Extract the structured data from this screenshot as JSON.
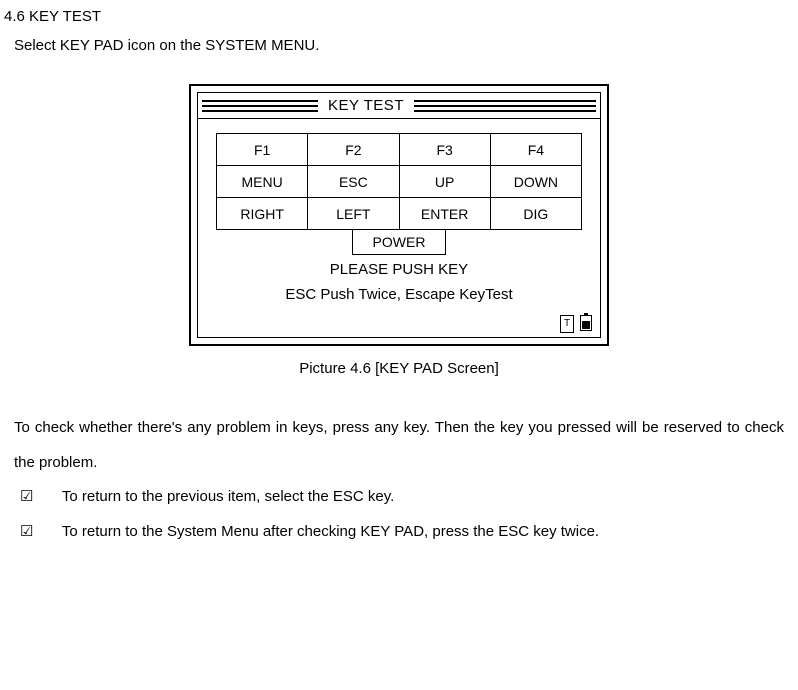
{
  "section": {
    "title": "4.6 KEY TEST",
    "intro": "Select KEY PAD icon on the SYSTEM MENU."
  },
  "screen": {
    "title": "KEY TEST",
    "keys": {
      "r1c1": "F1",
      "r1c2": "F2",
      "r1c3": "F3",
      "r1c4": "F4",
      "r2c1": "MENU",
      "r2c2": "ESC",
      "r2c3": "UP",
      "r2c4": "DOWN",
      "r3c1": "RIGHT",
      "r3c2": "LEFT",
      "r3c3": "ENTER",
      "r3c4": "DIG"
    },
    "power": "POWER",
    "msg1": "PLEASE PUSH KEY",
    "msg2": "ESC Push Twice, Escape KeyTest",
    "status_t": "T"
  },
  "caption": "Picture 4.6 [KEY PAD Screen]",
  "body": {
    "para": "To check whether there's any problem in keys, press any key. Then the key you pressed will be reserved to check the problem.",
    "bullet1": "To return to the previous item, select the ESC key.",
    "bullet2": "To return to the System Menu after checking KEY PAD, press the ESC key twice."
  },
  "glyphs": {
    "check": "☑"
  }
}
